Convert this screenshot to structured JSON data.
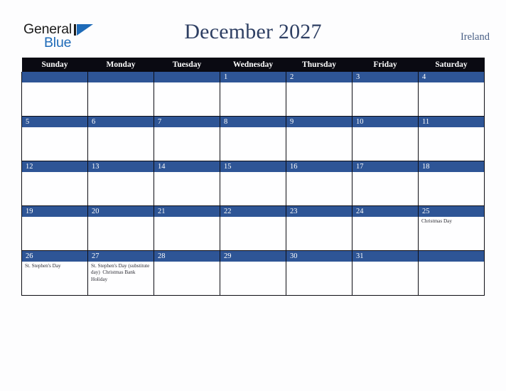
{
  "brand": {
    "name_top": "General",
    "name_bottom": "Blue",
    "flag_icon": "flag-triangle-icon",
    "color_dark": "#1c1c1c",
    "color_blue": "#1e6bb8"
  },
  "header": {
    "title": "December 2027",
    "country": "Ireland",
    "title_color": "#2e3f63",
    "country_color": "#4a6086"
  },
  "calendar": {
    "weekday_headers": [
      "Sunday",
      "Monday",
      "Tuesday",
      "Wednesday",
      "Thursday",
      "Friday",
      "Saturday"
    ],
    "header_bg": "#0a0a12",
    "daybar_bg": "#2e5596",
    "cell_bg": "#fefeff",
    "grid_line": "#0d0d14",
    "weeks": [
      [
        {
          "date": "",
          "events": []
        },
        {
          "date": "",
          "events": []
        },
        {
          "date": "",
          "events": []
        },
        {
          "date": "1",
          "events": []
        },
        {
          "date": "2",
          "events": []
        },
        {
          "date": "3",
          "events": []
        },
        {
          "date": "4",
          "events": []
        }
      ],
      [
        {
          "date": "5",
          "events": []
        },
        {
          "date": "6",
          "events": []
        },
        {
          "date": "7",
          "events": []
        },
        {
          "date": "8",
          "events": []
        },
        {
          "date": "9",
          "events": []
        },
        {
          "date": "10",
          "events": []
        },
        {
          "date": "11",
          "events": []
        }
      ],
      [
        {
          "date": "12",
          "events": []
        },
        {
          "date": "13",
          "events": []
        },
        {
          "date": "14",
          "events": []
        },
        {
          "date": "15",
          "events": []
        },
        {
          "date": "16",
          "events": []
        },
        {
          "date": "17",
          "events": []
        },
        {
          "date": "18",
          "events": []
        }
      ],
      [
        {
          "date": "19",
          "events": []
        },
        {
          "date": "20",
          "events": []
        },
        {
          "date": "21",
          "events": []
        },
        {
          "date": "22",
          "events": []
        },
        {
          "date": "23",
          "events": []
        },
        {
          "date": "24",
          "events": []
        },
        {
          "date": "25",
          "events": [
            "Christmas Day"
          ]
        }
      ],
      [
        {
          "date": "26",
          "events": [
            "St. Stephen's Day"
          ]
        },
        {
          "date": "27",
          "events": [
            "St. Stephen's Day (substitute day)",
            "Christmas Bank Holiday"
          ]
        },
        {
          "date": "28",
          "events": []
        },
        {
          "date": "29",
          "events": []
        },
        {
          "date": "30",
          "events": []
        },
        {
          "date": "31",
          "events": []
        },
        {
          "date": "",
          "events": []
        }
      ]
    ]
  }
}
